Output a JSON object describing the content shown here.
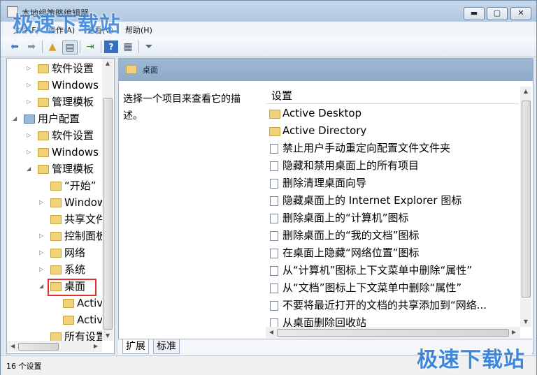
{
  "window": {
    "title": "本地组策略编辑器",
    "controls": [
      "▬",
      "▢",
      "✕"
    ]
  },
  "menu": [
    "文件(F)",
    "操作(A)",
    "查看(V)",
    "帮助(H)"
  ],
  "tree": [
    {
      "label": "软件设置",
      "indent": 2,
      "expand": "▷"
    },
    {
      "label": "Windows",
      "indent": 2,
      "expand": "▷"
    },
    {
      "label": "管理模板",
      "indent": 2,
      "expand": "▷"
    },
    {
      "label": "用户配置",
      "indent": 1,
      "expand": "◢"
    },
    {
      "label": "软件设置",
      "indent": 2,
      "expand": "▷"
    },
    {
      "label": "Windows",
      "indent": 2,
      "expand": "▷"
    },
    {
      "label": "管理模板",
      "indent": 2,
      "expand": "◢"
    },
    {
      "label": "“开始”",
      "indent": 3,
      "expand": ""
    },
    {
      "label": "Window",
      "indent": 3,
      "expand": "▷"
    },
    {
      "label": "共享文件",
      "indent": 3,
      "expand": ""
    },
    {
      "label": "控制面板",
      "indent": 3,
      "expand": "▷"
    },
    {
      "label": "网络",
      "indent": 3,
      "expand": "▷"
    },
    {
      "label": "系统",
      "indent": 3,
      "expand": "▷"
    },
    {
      "label": "桌面",
      "indent": 3,
      "expand": "◢",
      "selected": true
    },
    {
      "label": "Activ",
      "indent": 4,
      "expand": ""
    },
    {
      "label": "Activ",
      "indent": 4,
      "expand": ""
    },
    {
      "label": "所有设置",
      "indent": 3,
      "expand": ""
    }
  ],
  "right_pane": {
    "header_title": "桌面",
    "description": "选择一个项目来查看它的描述。",
    "column_header": "设置",
    "items": [
      {
        "type": "folder",
        "label": "Active Desktop"
      },
      {
        "type": "folder",
        "label": "Active Directory"
      },
      {
        "type": "policy",
        "label": "禁止用户手动重定向配置文件文件夹"
      },
      {
        "type": "policy",
        "label": "隐藏和禁用桌面上的所有项目"
      },
      {
        "type": "policy",
        "label": "删除清理桌面向导"
      },
      {
        "type": "policy",
        "label": "隐藏桌面上的 Internet Explorer 图标"
      },
      {
        "type": "policy",
        "label": "删除桌面上的“计算机”图标"
      },
      {
        "type": "policy",
        "label": "删除桌面上的“我的文档”图标"
      },
      {
        "type": "policy",
        "label": "在桌面上隐藏“网络位置”图标"
      },
      {
        "type": "policy",
        "label": "从“计算机”图标上下文菜单中删除“属性”"
      },
      {
        "type": "policy",
        "label": "从“文档”图标上下文菜单中删除“属性”"
      },
      {
        "type": "policy",
        "label": "不要将最近打开的文档的共享添加到“网络..."
      },
      {
        "type": "policy",
        "label": "从桌面删除回收站"
      }
    ]
  },
  "tabs": [
    "扩展",
    "标准"
  ],
  "status": "16 个设置",
  "watermark": "极速下载站",
  "colors": {
    "header_blue": "#8fabca",
    "selection_box": "#e0302a",
    "watermark": "#3d86d9"
  }
}
